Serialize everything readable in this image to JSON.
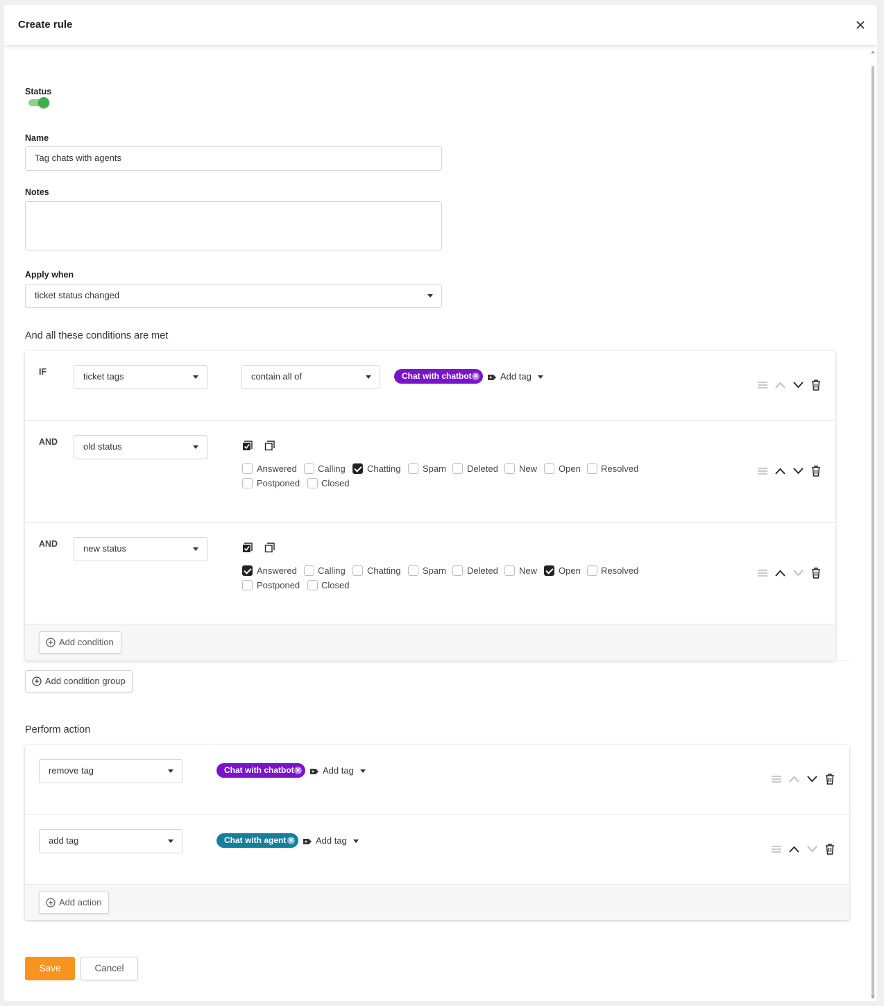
{
  "dialog": {
    "title": "Create rule"
  },
  "form": {
    "status_label": "Status",
    "status_on": true,
    "name_label": "Name",
    "name_value": "Tag chats with agents",
    "notes_label": "Notes",
    "notes_value": "",
    "apply_when_label": "Apply when",
    "apply_when_value": "ticket status changed"
  },
  "conditions": {
    "title": "And all these conditions are met",
    "rows": [
      {
        "keyword": "IF",
        "field": "ticket tags",
        "operator": "contain all of",
        "tag": "Chat with chatbot",
        "tag_color": "#7a14c9",
        "add_tag_label": "Add tag"
      },
      {
        "keyword": "AND",
        "field": "old status",
        "statuses": [
          {
            "label": "Answered",
            "checked": false
          },
          {
            "label": "Calling",
            "checked": false
          },
          {
            "label": "Chatting",
            "checked": true
          },
          {
            "label": "Spam",
            "checked": false
          },
          {
            "label": "Deleted",
            "checked": false
          },
          {
            "label": "New",
            "checked": false
          },
          {
            "label": "Open",
            "checked": false
          },
          {
            "label": "Resolved",
            "checked": false
          },
          {
            "label": "Postponed",
            "checked": false
          },
          {
            "label": "Closed",
            "checked": false
          }
        ]
      },
      {
        "keyword": "AND",
        "field": "new status",
        "statuses": [
          {
            "label": "Answered",
            "checked": true
          },
          {
            "label": "Calling",
            "checked": false
          },
          {
            "label": "Chatting",
            "checked": false
          },
          {
            "label": "Spam",
            "checked": false
          },
          {
            "label": "Deleted",
            "checked": false
          },
          {
            "label": "New",
            "checked": false
          },
          {
            "label": "Open",
            "checked": true
          },
          {
            "label": "Resolved",
            "checked": false
          },
          {
            "label": "Postponed",
            "checked": false
          },
          {
            "label": "Closed",
            "checked": false
          }
        ]
      }
    ],
    "add_condition_label": "Add condition",
    "add_group_label": "Add condition group"
  },
  "actions": {
    "title": "Perform action",
    "rows": [
      {
        "type": "remove tag",
        "tag": "Chat with chatbot",
        "tag_color": "#7a14c9",
        "add_tag_label": "Add tag"
      },
      {
        "type": "add tag",
        "tag": "Chat with agent",
        "tag_color": "#167f9c",
        "add_tag_label": "Add tag"
      }
    ],
    "add_action_label": "Add action"
  },
  "footer": {
    "save_label": "Save",
    "cancel_label": "Cancel"
  },
  "colors": {
    "accent": "#f7931e",
    "toggle_on": "#3fae49"
  }
}
